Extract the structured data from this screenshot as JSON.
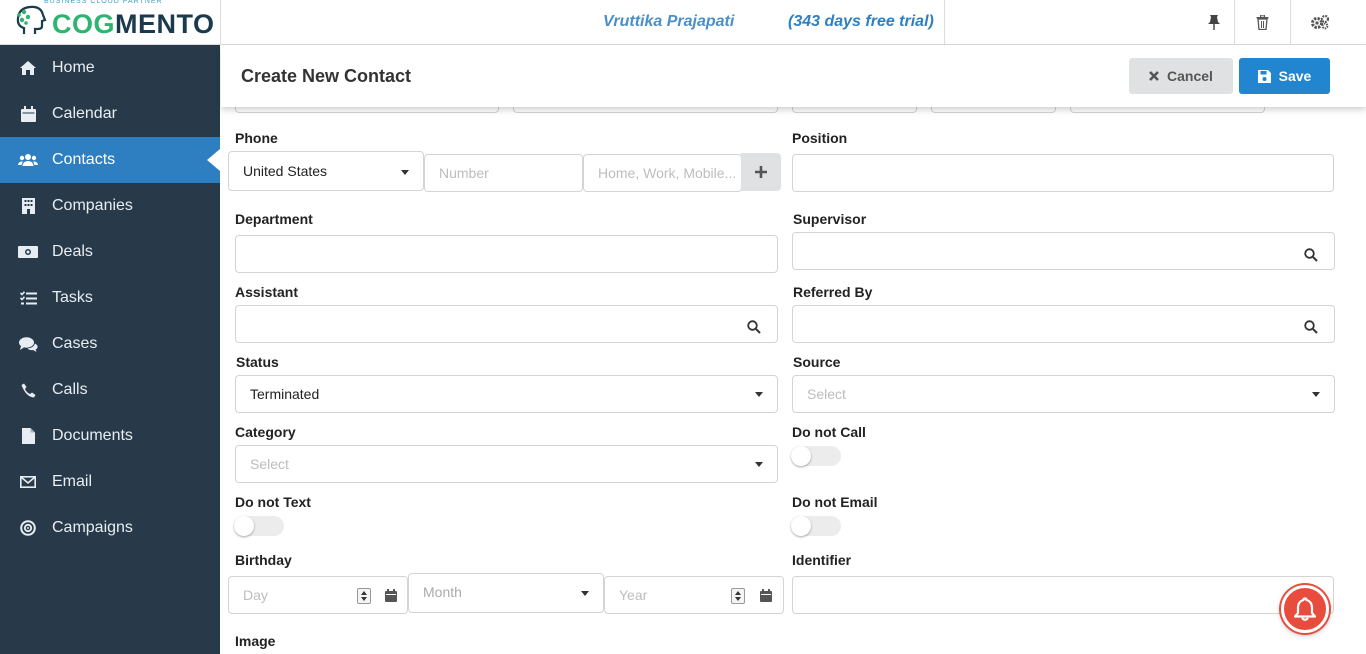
{
  "brand": {
    "name_green": "COG",
    "name_dark": "MENTO",
    "tagline": "BUSINESS CLOUD PARTNER"
  },
  "topbar": {
    "user": "Vruttika Prajapati",
    "trial": "(343 days free trial)",
    "icons": [
      "pin-icon",
      "trash-icon",
      "settings-icon"
    ]
  },
  "sidebar": {
    "items": [
      {
        "label": "Home",
        "icon": "home-icon"
      },
      {
        "label": "Calendar",
        "icon": "calendar-icon"
      },
      {
        "label": "Contacts",
        "icon": "users-icon",
        "active": true
      },
      {
        "label": "Companies",
        "icon": "building-icon"
      },
      {
        "label": "Deals",
        "icon": "money-icon"
      },
      {
        "label": "Tasks",
        "icon": "tasks-icon"
      },
      {
        "label": "Cases",
        "icon": "comments-icon"
      },
      {
        "label": "Calls",
        "icon": "phone-icon"
      },
      {
        "label": "Documents",
        "icon": "document-icon"
      },
      {
        "label": "Email",
        "icon": "envelope-icon"
      },
      {
        "label": "Campaigns",
        "icon": "bullseye-icon"
      }
    ]
  },
  "header": {
    "title": "Create New Contact",
    "cancel": "Cancel",
    "save": "Save"
  },
  "form": {
    "phone": {
      "label": "Phone",
      "country": "United States",
      "number_placeholder": "Number",
      "type_placeholder": "Home, Work, Mobile..."
    },
    "position": {
      "label": "Position",
      "value": ""
    },
    "department": {
      "label": "Department",
      "value": ""
    },
    "supervisor": {
      "label": "Supervisor",
      "value": ""
    },
    "assistant": {
      "label": "Assistant",
      "value": ""
    },
    "referred_by": {
      "label": "Referred By",
      "value": ""
    },
    "status": {
      "label": "Status",
      "value": "Terminated"
    },
    "source": {
      "label": "Source",
      "placeholder": "Select"
    },
    "category": {
      "label": "Category",
      "placeholder": "Select"
    },
    "do_not_call": {
      "label": "Do not Call",
      "on": false
    },
    "do_not_text": {
      "label": "Do not Text",
      "on": false
    },
    "do_not_email": {
      "label": "Do not Email",
      "on": false
    },
    "birthday": {
      "label": "Birthday",
      "day_placeholder": "Day",
      "month_placeholder": "Month",
      "year_placeholder": "Year"
    },
    "identifier": {
      "label": "Identifier",
      "value": ""
    },
    "image": {
      "label": "Image"
    }
  },
  "colors": {
    "sidebar": "#283a4a",
    "active": "#2d7fc1",
    "save": "#2185d0",
    "brand_green": "#2db46e",
    "notification": "#e84c3d"
  }
}
